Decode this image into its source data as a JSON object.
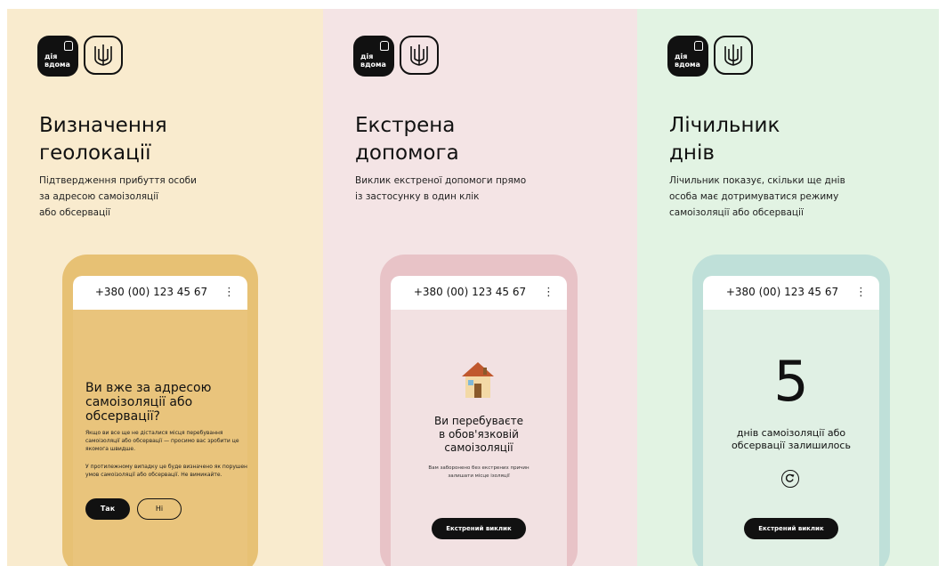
{
  "logo": {
    "text": "дія\nвдома",
    "emblem_icon": "trident-emblem-icon"
  },
  "panels": [
    {
      "title": "Визначення\nгеолокації",
      "description": "Підтвердження прибуття особи\nза адресою самоізоляції\nабо обсервації",
      "phone": {
        "number": "+380 (00) 123 45 67",
        "menu": "⋮",
        "question": "Ви вже за адресою\nсамоізоляції або\nобсервації?",
        "text1": "Якщо ви все ще не дісталися місця перебування самоізоляції або обсервації — просимо вас зробити це якомога швидше.",
        "text2": "У протилежному випадку це буде визначено як порушення умов самоізоляції або обсервації. Не вимикайте.",
        "yes": "Так",
        "no": "Ні"
      },
      "colors": {
        "bg": "#f9ebce",
        "phone": "#e7c174",
        "screen": "#e9c47c"
      }
    },
    {
      "title": "Екстрена\nдопомога",
      "description": "Виклик екстреної допомоги прямо\nіз застосунку в один клік",
      "phone": {
        "number": "+380 (00) 123 45 67",
        "menu": "⋮",
        "house_icon": "house-emoji-icon",
        "status": "Ви перебуваєте\nв обов'язковій\nсамоізоляції",
        "note": "Вам заборонено без екстрених причин\nзалишати місце ізоляції",
        "button": "Екстрений виклик"
      },
      "colors": {
        "bg": "#f4e4e5",
        "phone": "#e8c3c7",
        "screen": "#f2e1e2"
      }
    },
    {
      "title": "Лічильник\nднів",
      "description": "Лічильник показує, скільки ще днів\nособа має дотримуватися режиму\nсамоізоляції або обсервації",
      "phone": {
        "number": "+380 (00) 123 45 67",
        "menu": "⋮",
        "days": "5",
        "days_label": "днів самоізоляції або\nобсервації залишилось",
        "refresh_icon": "refresh-icon",
        "button": "Екстрений виклик"
      },
      "colors": {
        "bg": "#e2f3e3",
        "phone": "#bfe0d9",
        "screen": "#e0f0e4"
      }
    }
  ]
}
